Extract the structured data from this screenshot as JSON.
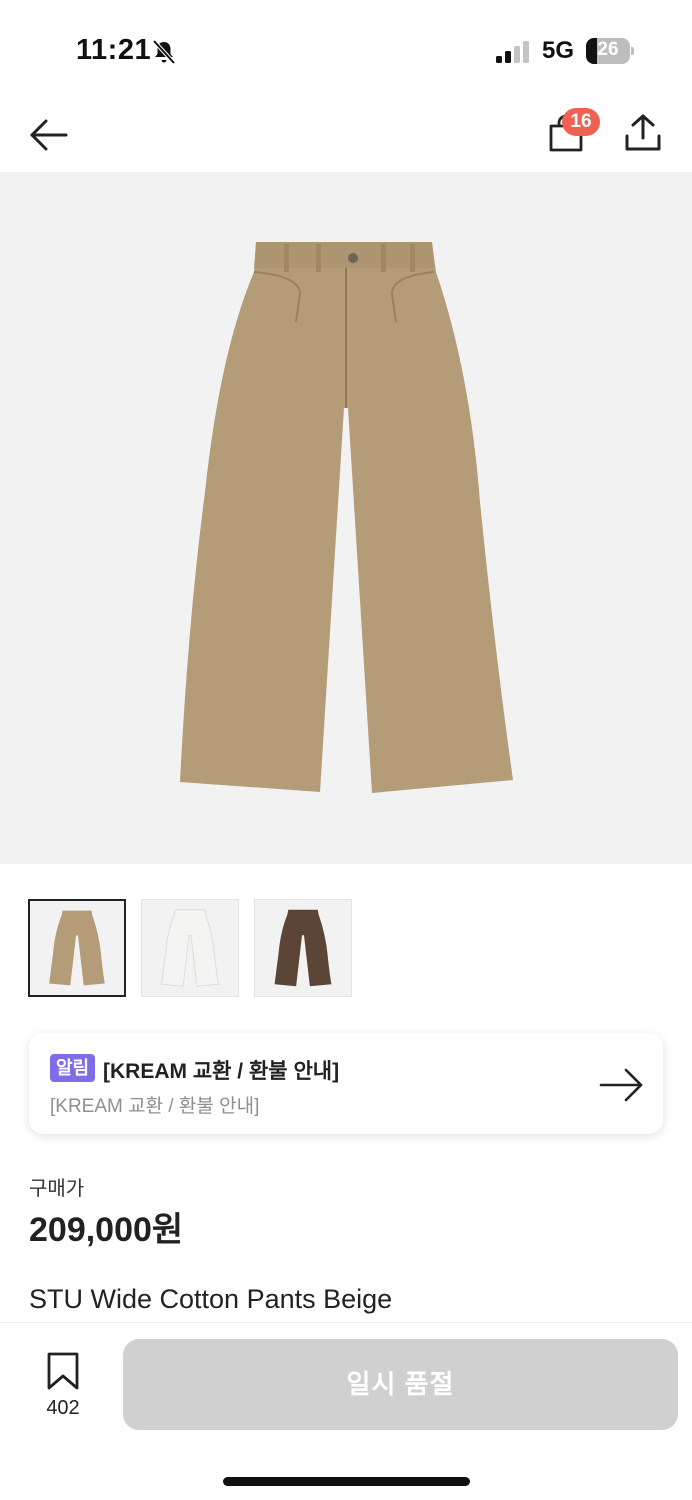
{
  "status_bar": {
    "time": "11:21",
    "network": "5G",
    "battery": "26",
    "battery_level": 0.26
  },
  "nav": {
    "cart_count": "16"
  },
  "thumbnails": [
    {
      "color": "#b59c78",
      "selected": true
    },
    {
      "color": "#f4f4f2",
      "selected": false
    },
    {
      "color": "#5a4536",
      "selected": false
    }
  ],
  "notice": {
    "tag": "알림",
    "title": "[KREAM 교환 / 환불 안내]",
    "subtitle": "[KREAM 교환 / 환불 안내]"
  },
  "price": {
    "label": "구매가",
    "value": "209,000원"
  },
  "product": {
    "name": "STU Wide Cotton Pants Beige",
    "color": "#b59c78"
  },
  "bottom_bar": {
    "wish_count": "402",
    "button_label": "일시 품절"
  }
}
